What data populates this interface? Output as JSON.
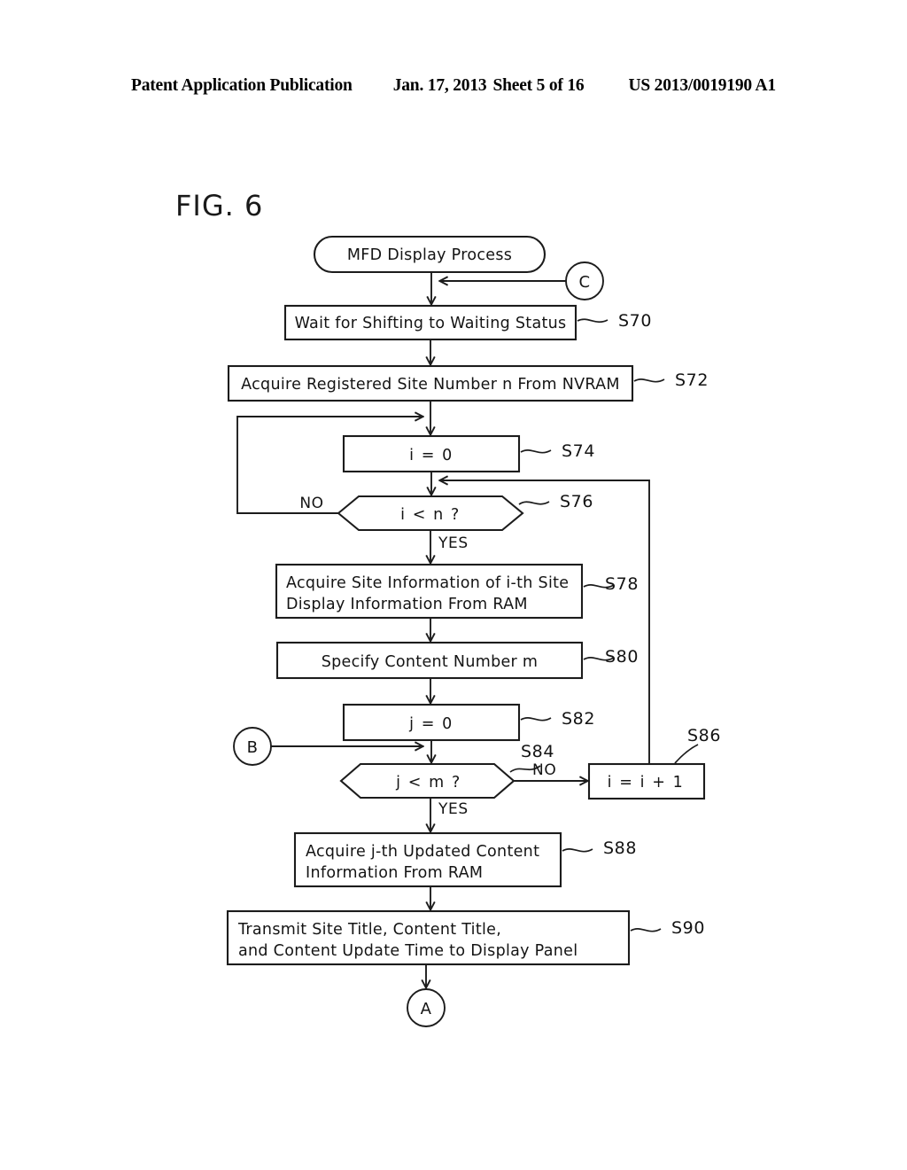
{
  "header": {
    "publication": "Patent Application Publication",
    "date": "Jan. 17, 2013",
    "sheet": "Sheet 5 of 16",
    "number": "US 2013/0019190 A1"
  },
  "figure": {
    "label": "FIG. 6"
  },
  "flowchart": {
    "start_terminator": "MFD Display Process",
    "end_connector_label": "A",
    "entry_connector_c": "C",
    "entry_connector_b": "B",
    "branch_yes": "YES",
    "branch_no": "NO",
    "steps": [
      {
        "id": "S70",
        "text_line1": "Wait for Shifting to Waiting Status",
        "text_line2": ""
      },
      {
        "id": "S72",
        "text_line1": "Acquire Registered Site Number n From NVRAM",
        "text_line2": ""
      },
      {
        "id": "S74",
        "text_line1": "i = 0",
        "text_line2": ""
      },
      {
        "id": "S76",
        "text_line1": "i < n ?",
        "text_line2": ""
      },
      {
        "id": "S78",
        "text_line1": "Acquire Site Information of i-th Site",
        "text_line2": "Display Information From RAM"
      },
      {
        "id": "S80",
        "text_line1": "Specify Content Number m",
        "text_line2": ""
      },
      {
        "id": "S82",
        "text_line1": "j = 0",
        "text_line2": ""
      },
      {
        "id": "S84",
        "text_line1": "j < m ?",
        "text_line2": ""
      },
      {
        "id": "S86",
        "text_line1": "i = i + 1",
        "text_line2": ""
      },
      {
        "id": "S88",
        "text_line1": "Acquire j-th Updated Content",
        "text_line2": "Information From RAM"
      },
      {
        "id": "S90",
        "text_line1": "Transmit Site Title, Content Title,",
        "text_line2": " and Content Update Time to Display Panel"
      }
    ]
  },
  "colors": {
    "ink": "#1c1c1c",
    "paper": "#ffffff"
  }
}
